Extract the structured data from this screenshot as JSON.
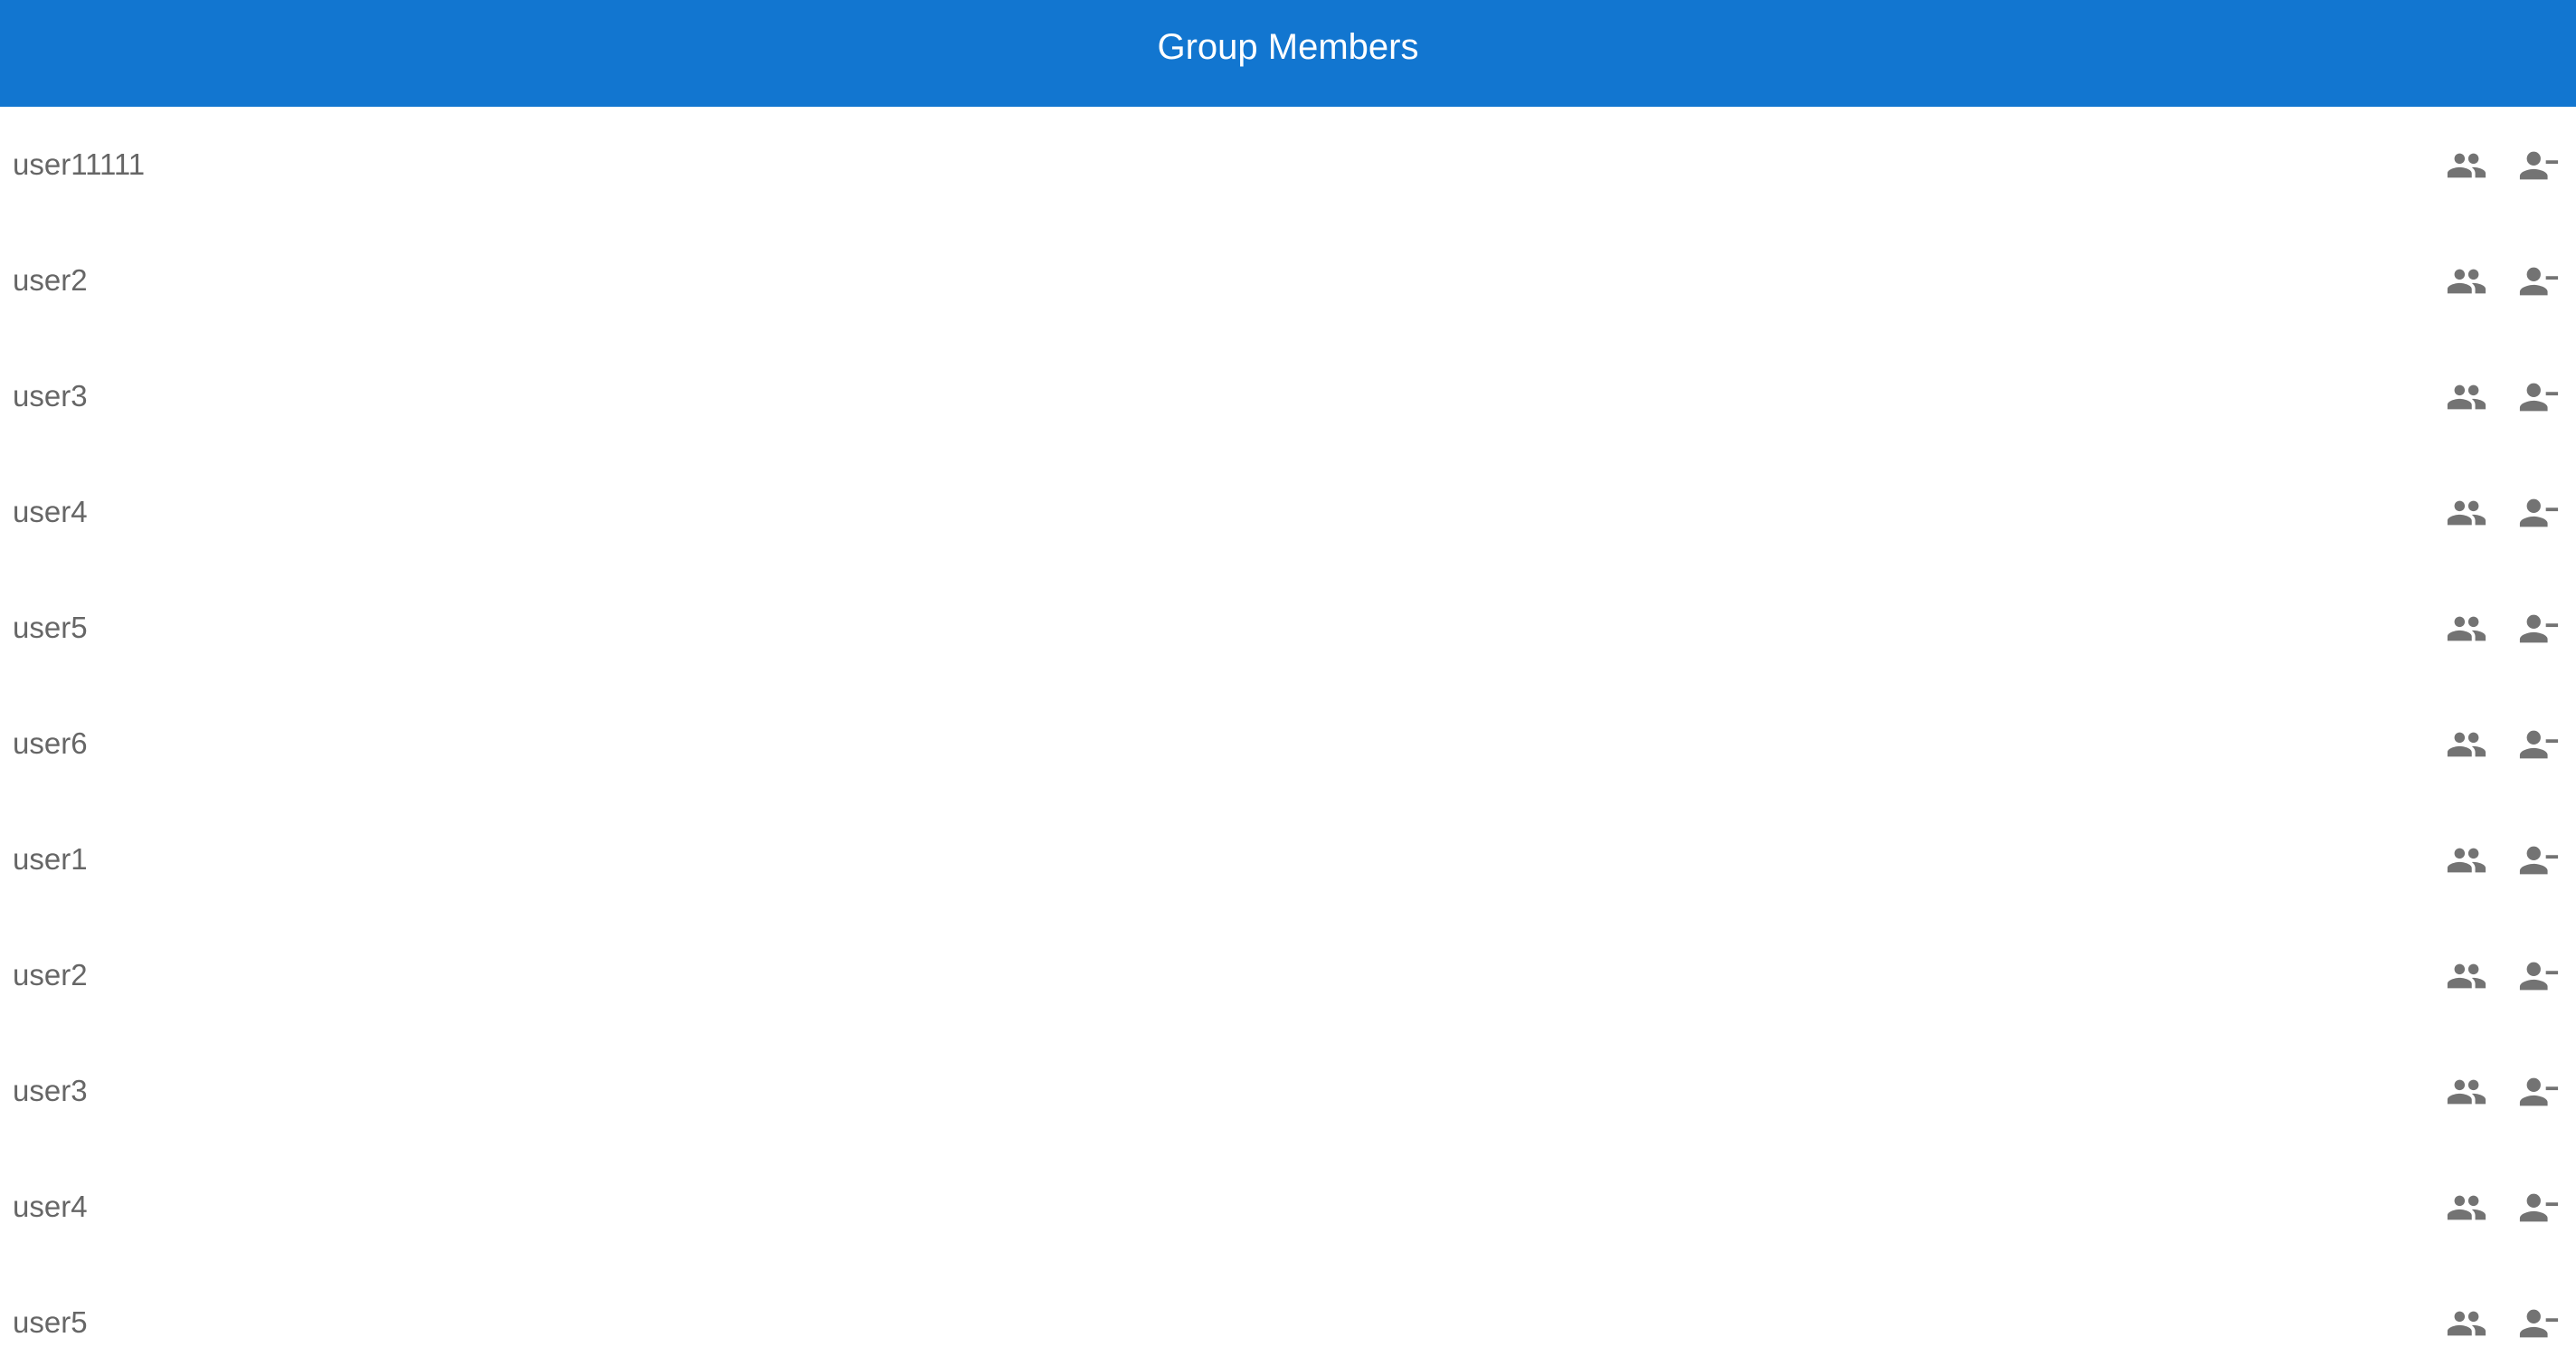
{
  "header": {
    "title": "Group Members"
  },
  "members": [
    {
      "name": "user11111"
    },
    {
      "name": "user2"
    },
    {
      "name": "user3"
    },
    {
      "name": "user4"
    },
    {
      "name": "user5"
    },
    {
      "name": "user6"
    },
    {
      "name": "user1"
    },
    {
      "name": "user2"
    },
    {
      "name": "user3"
    },
    {
      "name": "user4"
    },
    {
      "name": "user5"
    }
  ],
  "icons": {
    "row_action_1": "people-icon",
    "row_action_2": "remove-person-icon"
  },
  "colors": {
    "header_bg": "#1276d0",
    "icon": "#737373",
    "text": "#666666"
  }
}
